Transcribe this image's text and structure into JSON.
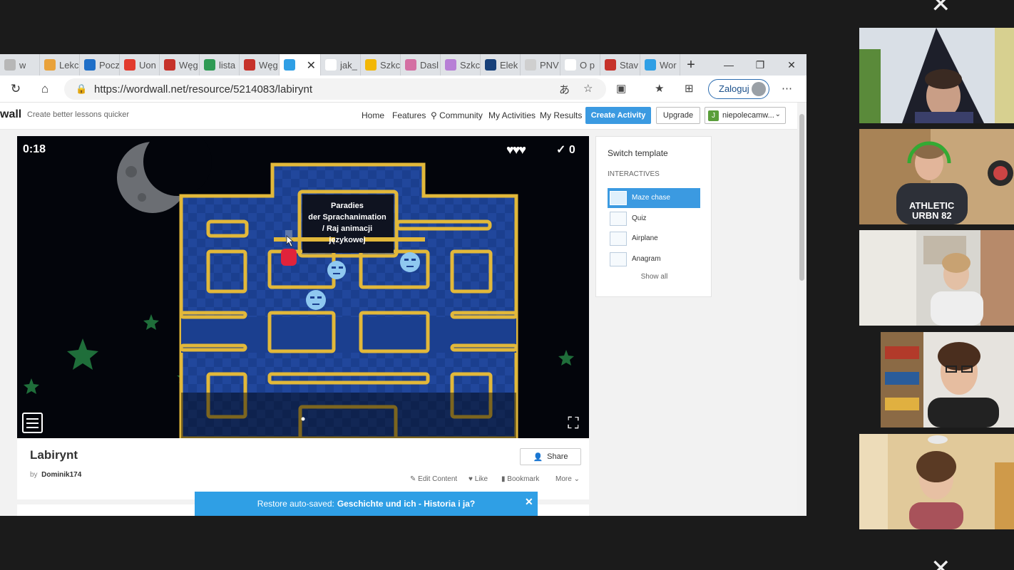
{
  "tabs": [
    {
      "label": "w",
      "color": "#b7b7b7"
    },
    {
      "label": "Lekc",
      "color": "#e9a23b"
    },
    {
      "label": "Pocz",
      "color": "#1f6fc8"
    },
    {
      "label": "Uon",
      "color": "#e23b2e"
    },
    {
      "label": "Węg",
      "color": "#c6322a"
    },
    {
      "label": "lista",
      "color": "#2f9a54"
    },
    {
      "label": "Węg",
      "color": "#c6322a"
    },
    {
      "label": "",
      "color": "#2f9fe5",
      "active": true
    },
    {
      "label": "jak_",
      "color": "#ffffff"
    },
    {
      "label": "Szkc",
      "color": "#f2b705"
    },
    {
      "label": "Dasl",
      "color": "#d46fa3"
    },
    {
      "label": "Szkc",
      "color": "#b77fd6"
    },
    {
      "label": "Elek",
      "color": "#17407a"
    },
    {
      "label": "PNV",
      "color": "#cfcfcf"
    },
    {
      "label": "O p",
      "color": "#ffffff"
    },
    {
      "label": "Stav",
      "color": "#c6322a"
    },
    {
      "label": "Wor",
      "color": "#2f9fe5"
    }
  ],
  "address": {
    "url": "https://wordwall.net/resource/5214083/labirynt",
    "signin_label": "Zaloguj"
  },
  "site": {
    "logo": "wall",
    "tagline": "Create better lessons quicker",
    "nav": {
      "home": "Home",
      "features": "Features",
      "community": "Community",
      "my_activities": "My Activities",
      "my_results": "My Results"
    },
    "create_label": "Create Activity",
    "upgrade_label": "Upgrade",
    "user_initial": "J",
    "user_name": "niepolecamw..."
  },
  "game": {
    "timer": "0:18",
    "lives": "♥♥♥",
    "score": "0",
    "question_line1": "Paradies",
    "question_line2": "der Sprachanimation",
    "question_line3": "/ Raj animacji",
    "question_line4": "językowej"
  },
  "activity": {
    "title": "Labirynt",
    "by_prefix": "by",
    "author": "Dominik174",
    "share_label": "Share",
    "edit_label": "Edit Content",
    "like_label": "Like",
    "bookmark_label": "Bookmark",
    "more_label": "More"
  },
  "sidebar": {
    "title": "Switch template",
    "section": "INTERACTIVES",
    "templates": [
      {
        "label": "Maze chase",
        "selected": true
      },
      {
        "label": "Quiz"
      },
      {
        "label": "Airplane"
      },
      {
        "label": "Anagram"
      }
    ],
    "show_all": "Show all"
  },
  "restore": {
    "prefix": "Restore auto-saved:",
    "name": "Geschichte und ich - Historia i ja?"
  },
  "colors": {
    "accent": "#3b9ae1",
    "maze_blue": "#1b3f8f",
    "maze_gold": "#e2b83a"
  }
}
